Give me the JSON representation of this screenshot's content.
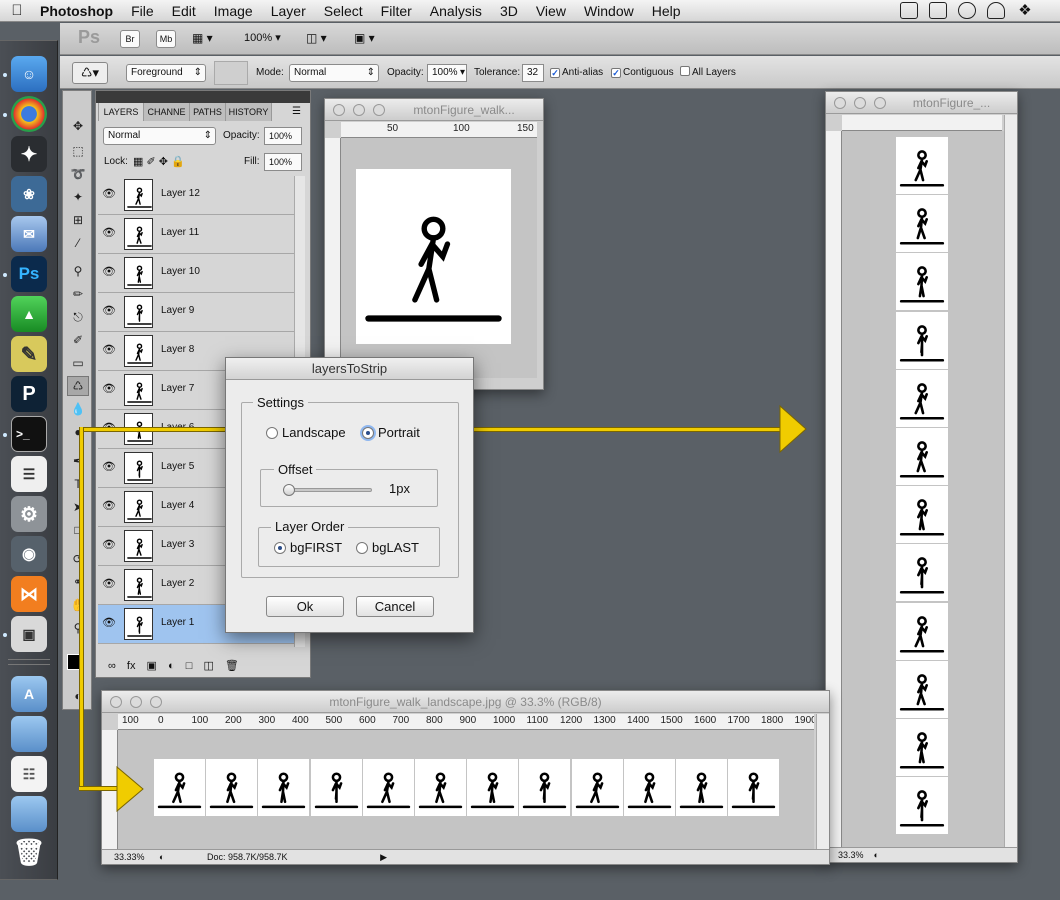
{
  "menubar": {
    "app": "Photoshop",
    "items": [
      "File",
      "Edit",
      "Image",
      "Layer",
      "Select",
      "Filter",
      "Analysis",
      "3D",
      "View",
      "Window",
      "Help"
    ]
  },
  "appbar": {
    "ps_logo": "Ps",
    "br": "Br",
    "mb": "Mb",
    "zoom": "100%"
  },
  "options": {
    "fill_source": "Foreground",
    "mode_label": "Mode:",
    "mode": "Normal",
    "opacity_label": "Opacity:",
    "opacity": "100%",
    "tolerance_label": "Tolerance:",
    "tolerance": "32",
    "anti_alias": "Anti-alias",
    "contiguous": "Contiguous",
    "all_layers": "All Layers"
  },
  "layers_panel": {
    "tabs": [
      "LAYERS",
      "CHANNE",
      "PATHS",
      "HISTORY"
    ],
    "blend": "Normal",
    "opacity_label": "Opacity:",
    "opacity": "100%",
    "lock_label": "Lock:",
    "fill_label": "Fill:",
    "fill": "100%",
    "layers": [
      "Layer 12",
      "Layer 11",
      "Layer 10",
      "Layer 9",
      "Layer 8",
      "Layer 7",
      "Layer 6",
      "Layer 5",
      "Layer 4",
      "Layer 3",
      "Layer 2",
      "Layer 1"
    ]
  },
  "doc_small": {
    "title": "mtonFigure_walk...",
    "ruler_h": [
      "50",
      "100",
      "150"
    ],
    "ruler_v": [
      "5",
      "0",
      "1",
      "0",
      "0"
    ]
  },
  "doc_portrait": {
    "title": "mtonFigure_...",
    "zoom": "33.3%"
  },
  "doc_landscape": {
    "title": "mtonFigure_walk_landscape.jpg @ 33.3% (RGB/8)",
    "zoom": "33.33%",
    "doc_info": "Doc: 958.7K/958.7K",
    "ruler_h": [
      "100",
      "0",
      "100",
      "200",
      "300",
      "400",
      "500",
      "600",
      "700",
      "800",
      "900",
      "1000",
      "1100",
      "1200",
      "1300",
      "1400",
      "1500",
      "1600",
      "1700",
      "1800",
      "1900"
    ]
  },
  "dialog": {
    "title": "layersToStrip",
    "settings": "Settings",
    "landscape": "Landscape",
    "portrait": "Portrait",
    "orientation": "Portrait",
    "offset_label": "Offset",
    "offset_value": "1px",
    "offset_fraction": 0.0,
    "order_label": "Layer Order",
    "bg_first": "bgFIRST",
    "bg_last": "bgLAST",
    "order": "bgFIRST",
    "ok": "Ok",
    "cancel": "Cancel"
  },
  "colors": {
    "arrow": "#f0cc00",
    "selected_layer": "#9fc4ef",
    "background": "#5a6066"
  }
}
